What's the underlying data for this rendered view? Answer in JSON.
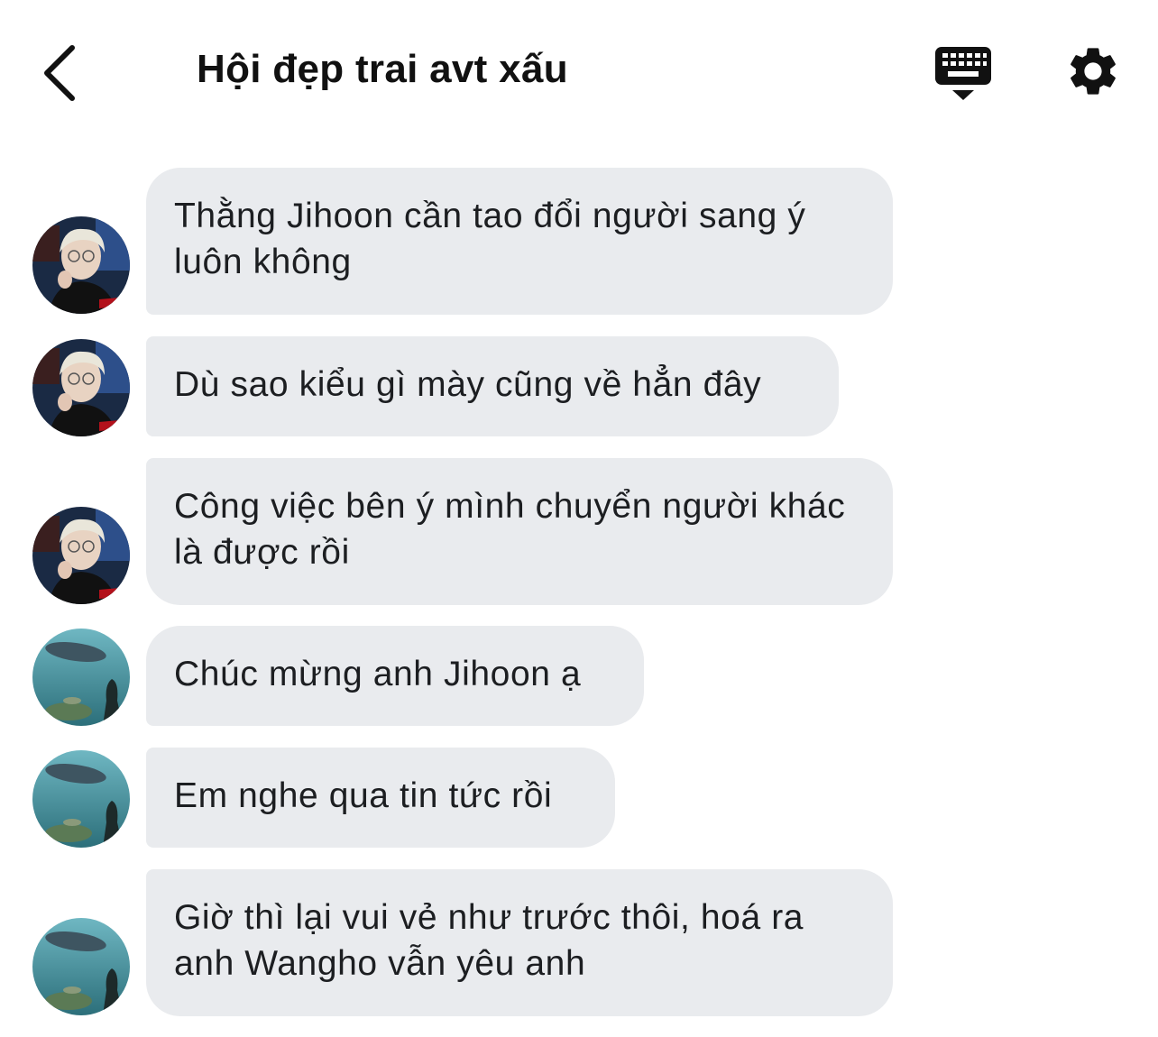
{
  "header": {
    "title": "Hội đẹp trai avt xấu",
    "back_icon": "chevron-left-icon",
    "keyboard_icon": "keyboard-icon",
    "settings_icon": "gear-icon"
  },
  "messages": [
    {
      "sender": "avatar-person",
      "text": "Thằng Jihoon cần tao đổi người sang ý luôn không"
    },
    {
      "sender": "avatar-person",
      "text": "Dù sao kiểu gì mày cũng về hẳn đây"
    },
    {
      "sender": "avatar-person",
      "text": "Công việc bên ý mình chuyển người khác là được rồi"
    },
    {
      "sender": "avatar-aquarium",
      "text": "Chúc mừng anh Jihoon ạ"
    },
    {
      "sender": "avatar-aquarium",
      "text": "Em nghe qua tin tức rồi"
    },
    {
      "sender": "avatar-aquarium",
      "text": "Giờ thì lại vui vẻ như trước thôi, hoá ra anh Wangho vẫn yêu anh"
    }
  ],
  "colors": {
    "bubble": "#e9ebee",
    "text": "#1c1e21",
    "icon": "#111111"
  }
}
